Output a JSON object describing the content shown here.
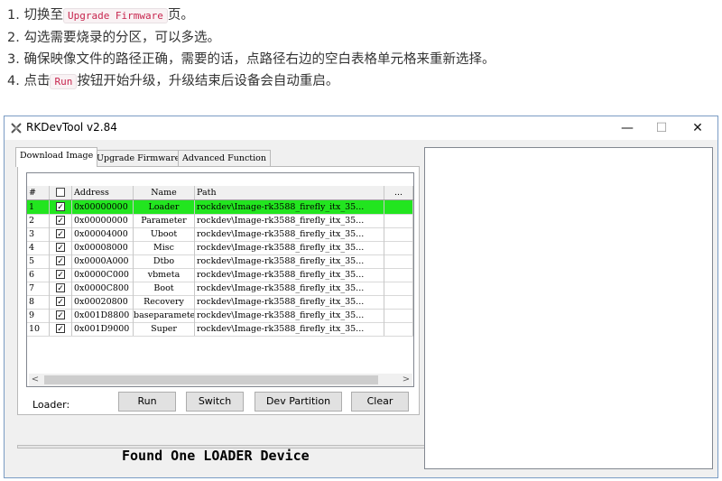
{
  "instructions": [
    {
      "prefix": "1. 切换至",
      "code": "Upgrade Firmware",
      "suffix": "页。"
    },
    {
      "prefix": "2. 勾选需要烧录的分区，可以多选。",
      "code": "",
      "suffix": ""
    },
    {
      "prefix": "3. 确保映像文件的路径正确，需要的话，点路径右边的空白表格单元格来重新选择。",
      "code": "",
      "suffix": ""
    },
    {
      "prefix": "4. 点击",
      "code": "Run",
      "suffix": "按钮开始升级，升级结束后设备会自动重启。"
    }
  ],
  "window": {
    "title": "RKDevTool v2.84",
    "minimize": "—",
    "maximize": "☐",
    "close": "✕"
  },
  "tabs": [
    {
      "label": "Download Image",
      "active": true
    },
    {
      "label": "Upgrade Firmware",
      "active": false
    },
    {
      "label": "Advanced Function",
      "active": false
    }
  ],
  "table": {
    "headers": {
      "num": "#",
      "check": "",
      "address": "Address",
      "name": "Name",
      "path": "Path",
      "more": "..."
    },
    "rows": [
      {
        "num": "1",
        "checked": "✓",
        "address": "0x00000000",
        "name": "Loader",
        "path": "rockdev\\Image-rk3588_firefly_itx_35...",
        "selected": true
      },
      {
        "num": "2",
        "checked": "✓",
        "address": "0x00000000",
        "name": "Parameter",
        "path": "rockdev\\Image-rk3588_firefly_itx_35...",
        "selected": false
      },
      {
        "num": "3",
        "checked": "✓",
        "address": "0x00004000",
        "name": "Uboot",
        "path": "rockdev\\Image-rk3588_firefly_itx_35...",
        "selected": false
      },
      {
        "num": "4",
        "checked": "✓",
        "address": "0x00008000",
        "name": "Misc",
        "path": "rockdev\\Image-rk3588_firefly_itx_35...",
        "selected": false
      },
      {
        "num": "5",
        "checked": "✓",
        "address": "0x0000A000",
        "name": "Dtbo",
        "path": "rockdev\\Image-rk3588_firefly_itx_35...",
        "selected": false
      },
      {
        "num": "6",
        "checked": "✓",
        "address": "0x0000C000",
        "name": "vbmeta",
        "path": "rockdev\\Image-rk3588_firefly_itx_35...",
        "selected": false
      },
      {
        "num": "7",
        "checked": "✓",
        "address": "0x0000C800",
        "name": "Boot",
        "path": "rockdev\\Image-rk3588_firefly_itx_35...",
        "selected": false
      },
      {
        "num": "8",
        "checked": "✓",
        "address": "0x00020800",
        "name": "Recovery",
        "path": "rockdev\\Image-rk3588_firefly_itx_35...",
        "selected": false
      },
      {
        "num": "9",
        "checked": "✓",
        "address": "0x001D8800",
        "name": "baseparameter",
        "path": "rockdev\\Image-rk3588_firefly_itx_35...",
        "selected": false
      },
      {
        "num": "10",
        "checked": "✓",
        "address": "0x001D9000",
        "name": "Super",
        "path": "rockdev\\Image-rk3588_firefly_itx_35...",
        "selected": false
      }
    ]
  },
  "scrollbar": {
    "left": "<",
    "right": ">"
  },
  "loader_label": "Loader:",
  "buttons": {
    "run": "Run",
    "switch": "Switch",
    "dev_partition": "Dev Partition",
    "clear": "Clear"
  },
  "status_text": "Found One LOADER Device",
  "colors": {
    "selected_row": "#22e51f",
    "code_text": "#c7254e"
  }
}
